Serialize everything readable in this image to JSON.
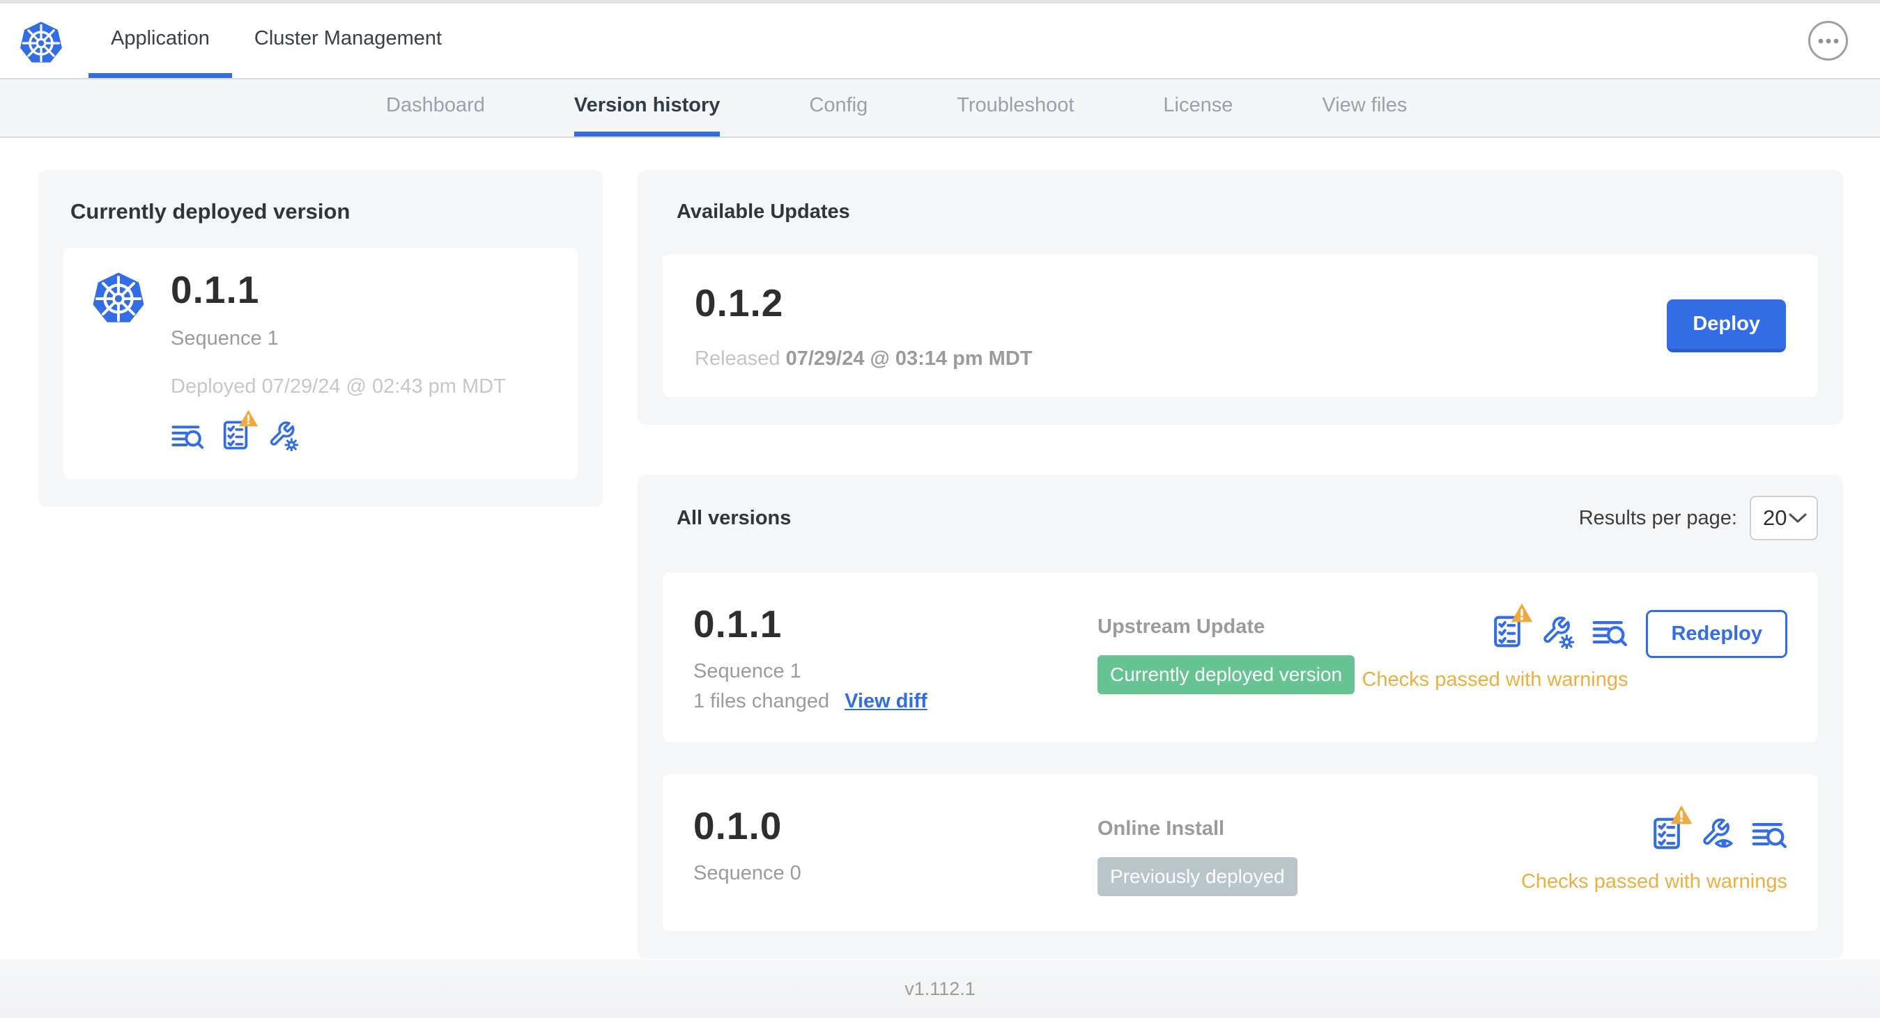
{
  "colors": {
    "accent_blue": "#326de6",
    "warning_orange": "#eeae3f",
    "success_green_badge": "#65c492",
    "muted_gray_badge": "#bac5c9",
    "card_background": "#f5f6f8"
  },
  "header": {
    "logo_icon": "kubernetes-logo",
    "tabs": [
      {
        "label": "Application",
        "active": true
      },
      {
        "label": "Cluster Management",
        "active": false
      }
    ],
    "menu_icon": "ellipsis-menu"
  },
  "subnav": {
    "tabs": [
      {
        "label": "Dashboard",
        "active": false
      },
      {
        "label": "Version history",
        "active": true
      },
      {
        "label": "Config",
        "active": false
      },
      {
        "label": "Troubleshoot",
        "active": false
      },
      {
        "label": "License",
        "active": false
      },
      {
        "label": "View files",
        "active": false
      }
    ]
  },
  "current_card": {
    "title": "Currently deployed version",
    "version": "0.1.1",
    "sequence": "Sequence 1",
    "deployed": "Deployed 07/29/24 @ 02:43 pm MDT",
    "icons": [
      "logs-icon",
      "preflight-checks-warning-icon",
      "edit-config-icon"
    ]
  },
  "available_updates": {
    "title": "Available Updates",
    "version": "0.1.2",
    "released_label": "Released",
    "released_date": "07/29/24 @ 03:14 pm MDT",
    "deploy_button": "Deploy"
  },
  "all_versions": {
    "title": "All versions",
    "results_per_page_label": "Results per page:",
    "results_per_page_value": "20",
    "versions": [
      {
        "version": "0.1.1",
        "sequence": "Sequence 1",
        "files_changed": "1 files changed",
        "view_diff": "View diff",
        "source": "Upstream Update",
        "status_badge": "Currently deployed version",
        "badge_color": "#65c492",
        "icons": [
          "preflight-checks-warning-icon",
          "edit-config-icon",
          "logs-icon"
        ],
        "action_button": "Redeploy",
        "checks_text": "Checks passed with warnings"
      },
      {
        "version": "0.1.0",
        "sequence": "Sequence 0",
        "source": "Online Install",
        "status_badge": "Previously deployed",
        "badge_color": "#bac5c9",
        "icons": [
          "preflight-checks-warning-icon",
          "view-config-icon",
          "logs-icon"
        ],
        "checks_text": "Checks passed with warnings"
      }
    ]
  },
  "footer": {
    "app_version": "v1.112.1"
  }
}
